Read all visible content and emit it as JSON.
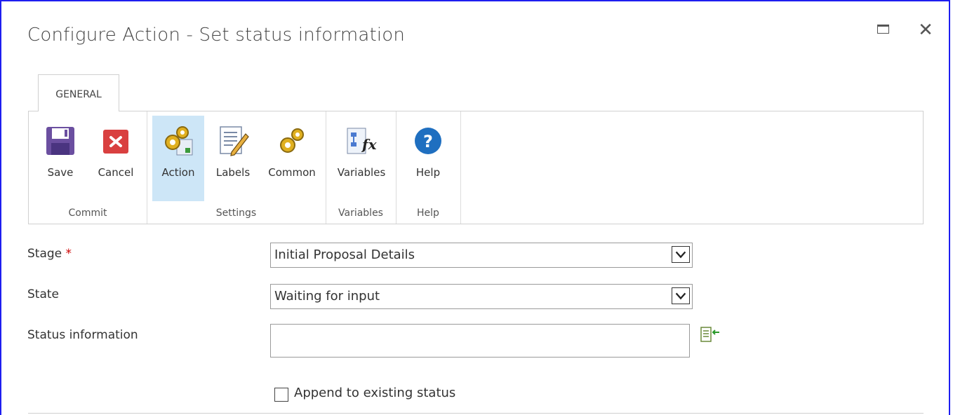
{
  "dialog": {
    "title": "Configure Action - Set status information",
    "maximize_icon": "maximize-icon",
    "close_icon": "close-icon",
    "close_glyph": "✕"
  },
  "ribbon": {
    "tab_label": "GENERAL",
    "groups": [
      {
        "label": "Commit",
        "buttons": [
          {
            "label": "Save",
            "icon": "save-icon"
          },
          {
            "label": "Cancel",
            "icon": "cancel-icon"
          }
        ]
      },
      {
        "label": "Settings",
        "buttons": [
          {
            "label": "Action",
            "icon": "action-gears-icon",
            "selected": true
          },
          {
            "label": "Labels",
            "icon": "labels-pencil-icon"
          },
          {
            "label": "Common",
            "icon": "common-gears-icon"
          }
        ]
      },
      {
        "label": "Variables",
        "buttons": [
          {
            "label": "Variables",
            "icon": "variables-fx-icon"
          }
        ]
      },
      {
        "label": "Help",
        "buttons": [
          {
            "label": "Help",
            "icon": "help-icon"
          }
        ]
      }
    ]
  },
  "form": {
    "stage": {
      "label": "Stage",
      "required_mark": "*",
      "value": "Initial Proposal Details"
    },
    "state": {
      "label": "State",
      "value": "Waiting for input"
    },
    "status_information": {
      "label": "Status information",
      "value": "",
      "insert_icon": "insert-reference-icon"
    },
    "append": {
      "label": "Append to existing status",
      "checked": false
    }
  },
  "colors": {
    "accent_border": "#1e1ef0",
    "selected_button": "#cde6f7",
    "required": "#cc0000"
  }
}
